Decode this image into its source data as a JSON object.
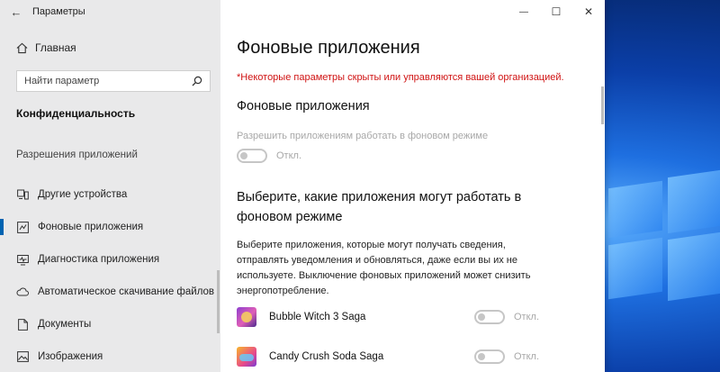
{
  "window": {
    "app_title": "Параметры",
    "back_icon": "arrow-left-icon",
    "controls": {
      "minimize": "—",
      "maximize": "☐",
      "close": "✕"
    }
  },
  "sidebar": {
    "home_label": "Главная",
    "search_placeholder": "Найти параметр",
    "section_title": "Конфиденциальность",
    "group_title": "Разрешения приложений",
    "items": [
      {
        "label": "Другие устройства",
        "icon": "devices-icon",
        "active": false
      },
      {
        "label": "Фоновые приложения",
        "icon": "background-apps-icon",
        "active": true
      },
      {
        "label": "Диагностика приложения",
        "icon": "diagnostics-icon",
        "active": false
      },
      {
        "label": "Автоматическое скачивание файлов",
        "icon": "cloud-icon",
        "active": false
      },
      {
        "label": "Документы",
        "icon": "document-icon",
        "active": false
      },
      {
        "label": "Изображения",
        "icon": "image-icon",
        "active": false
      }
    ]
  },
  "main": {
    "title": "Фоновые приложения",
    "org_note": "*Некоторые параметры скрыты или управляются вашей организацией.",
    "subtitle": "Фоновые приложения",
    "allow_label": "Разрешить приложениям работать в фоновом режиме",
    "allow_state": "Откл.",
    "choose_title": "Выберите, какие приложения могут работать в фоновом режиме",
    "choose_desc": "Выберите приложения, которые могут получать сведения, отправлять уведомления и обновляться, даже если вы их не используете. Выключение фоновых приложений может снизить энергопотребление.",
    "apps": [
      {
        "name": "Bubble Witch 3 Saga",
        "state": "Откл."
      },
      {
        "name": "Candy Crush Soda Saga",
        "state": "Откл."
      }
    ]
  }
}
